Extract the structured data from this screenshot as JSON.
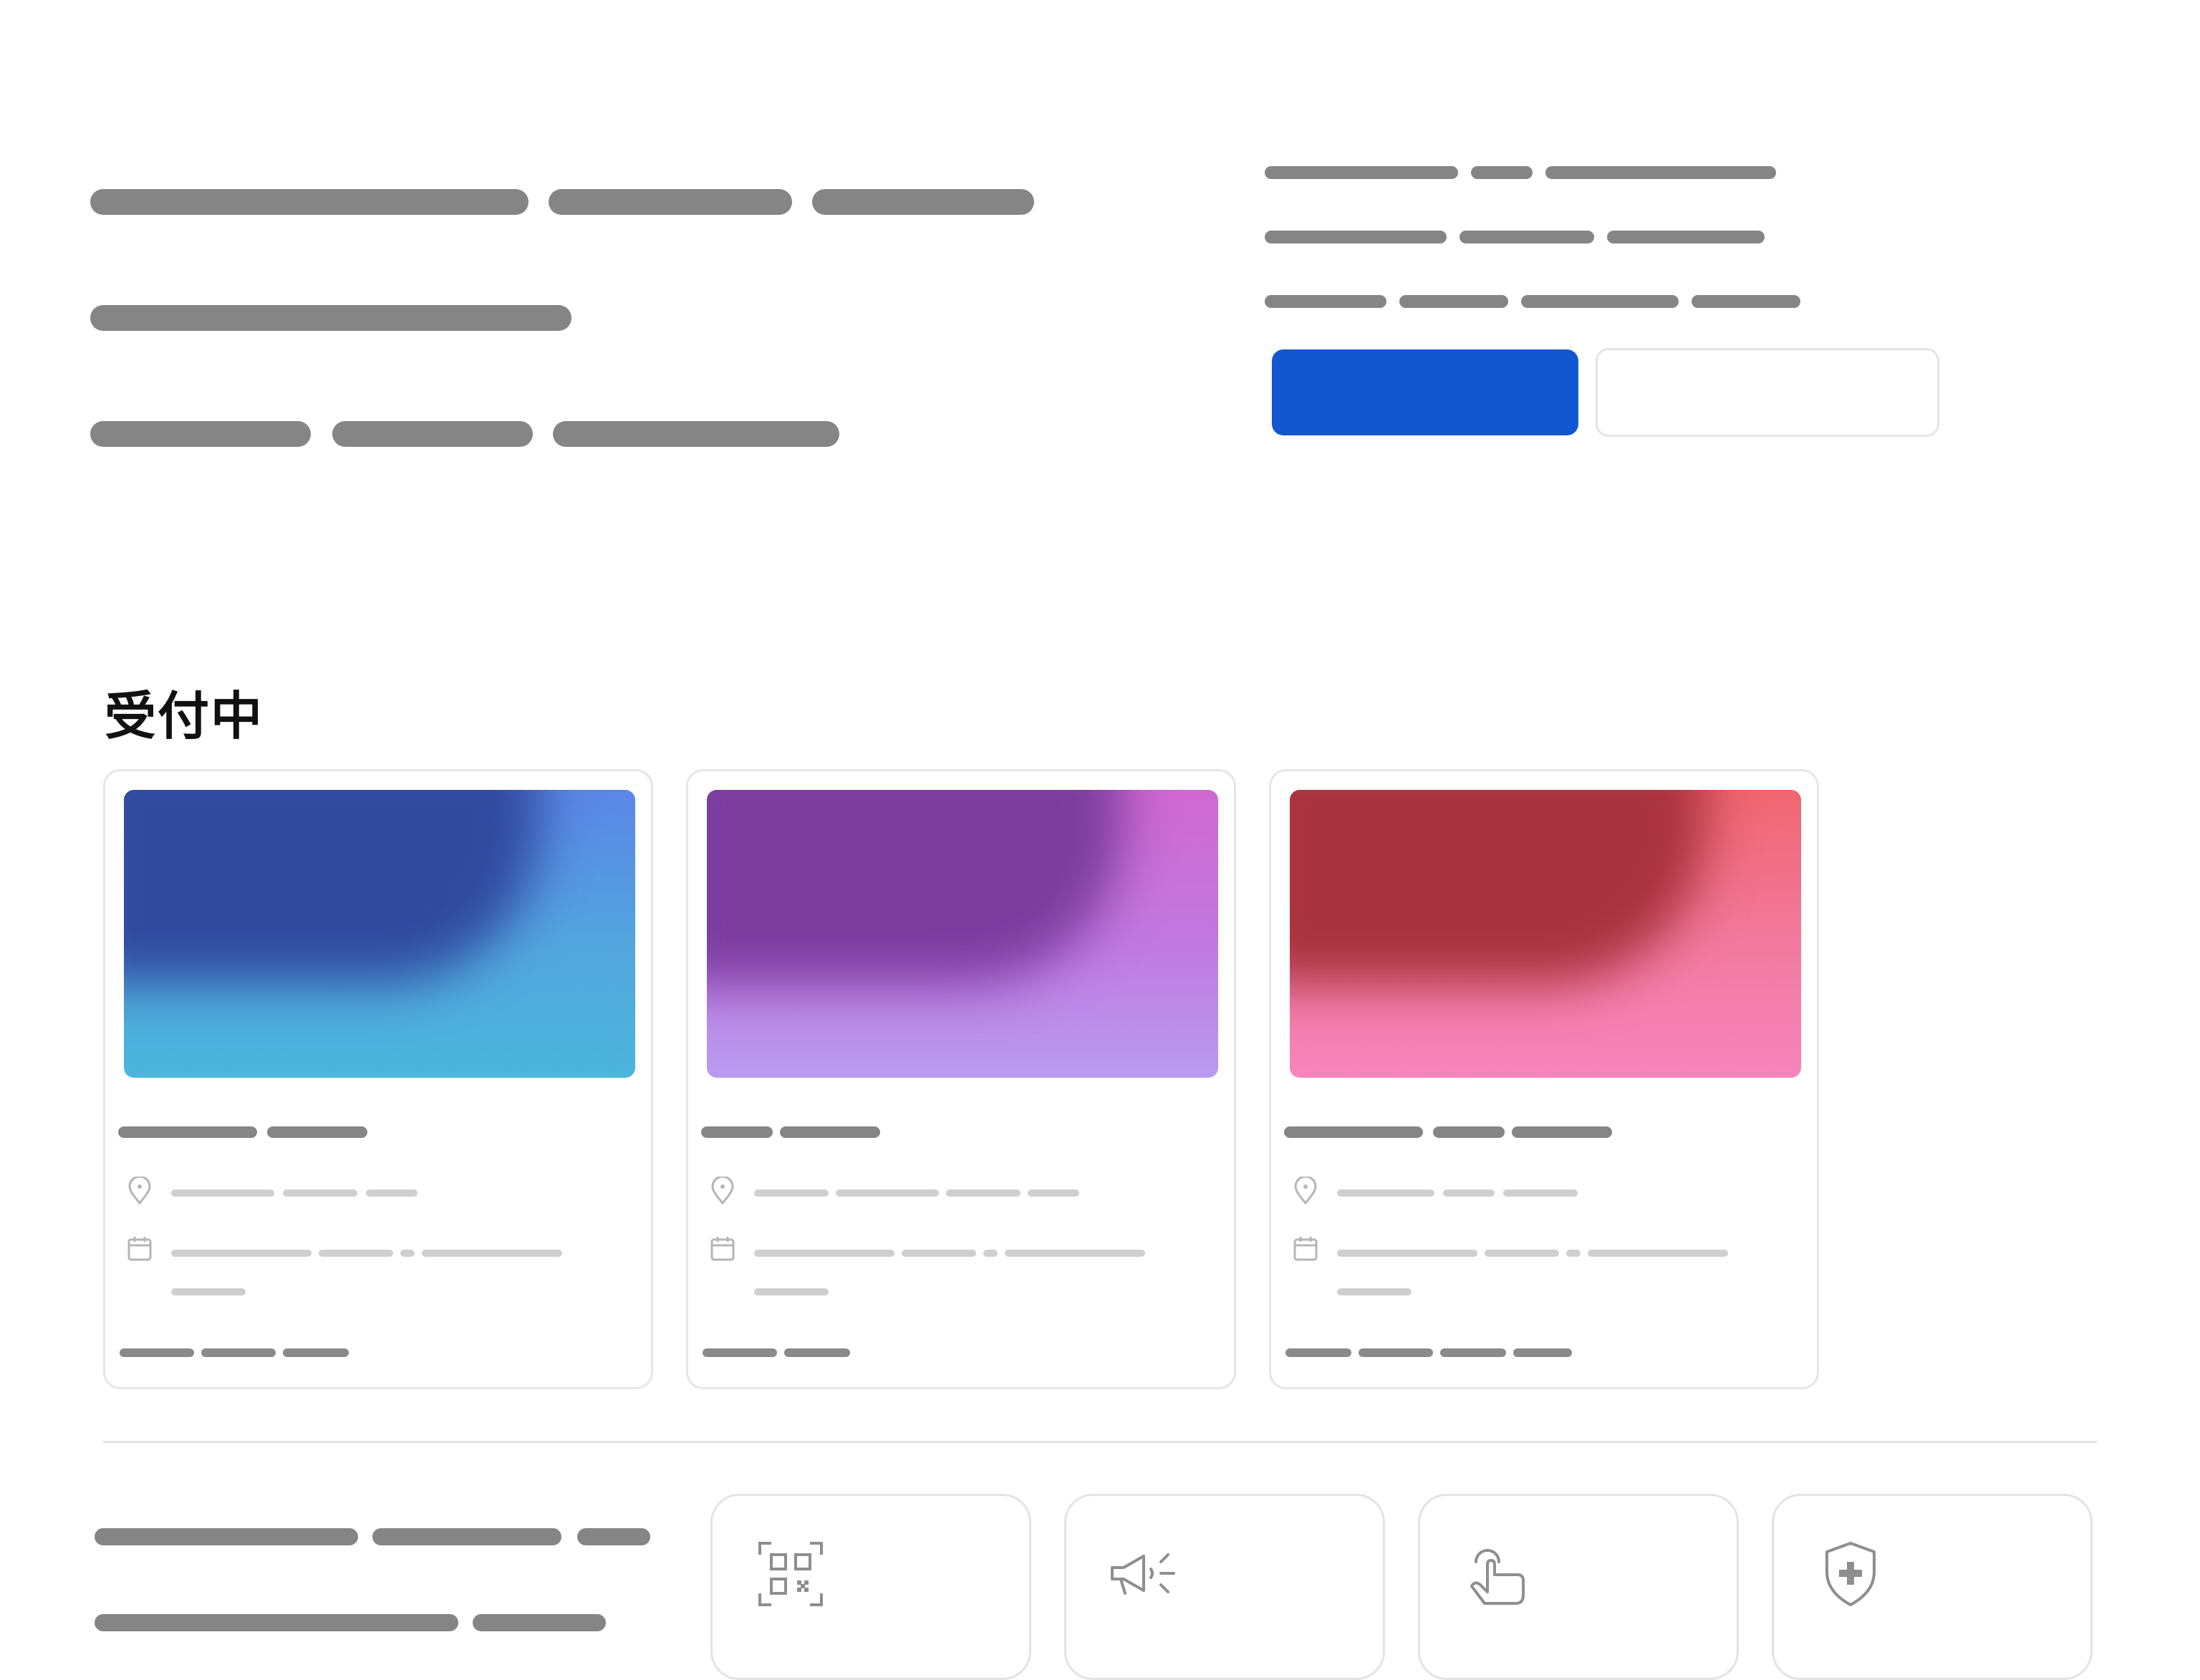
{
  "hero": {
    "primary_button_label": "",
    "secondary_button_label": ""
  },
  "section": {
    "title": "受付中"
  },
  "cards": [
    {
      "title": "",
      "location": "",
      "date": "",
      "footer": "",
      "thumb_colors": [
        "#2f4fa8",
        "#56a9e0",
        "#5b86e6"
      ]
    },
    {
      "title": "",
      "location": "",
      "date": "",
      "footer": "",
      "thumb_colors": [
        "#7a3d9e",
        "#c07ae0",
        "#d068d0"
      ]
    },
    {
      "title": "",
      "location": "",
      "date": "",
      "footer": "",
      "thumb_colors": [
        "#a8323e",
        "#f27aa8",
        "#f06670"
      ]
    }
  ],
  "features": [
    {
      "icon": "qr-code-icon",
      "label": ""
    },
    {
      "icon": "megaphone-icon",
      "label": ""
    },
    {
      "icon": "tap-hand-icon",
      "label": ""
    },
    {
      "icon": "shield-plus-icon",
      "label": ""
    }
  ],
  "colors": {
    "primary": "#1357d0",
    "border": "#e4e4e4",
    "placeholder_dark": "#858585",
    "placeholder_light": "#cfcfcf"
  }
}
